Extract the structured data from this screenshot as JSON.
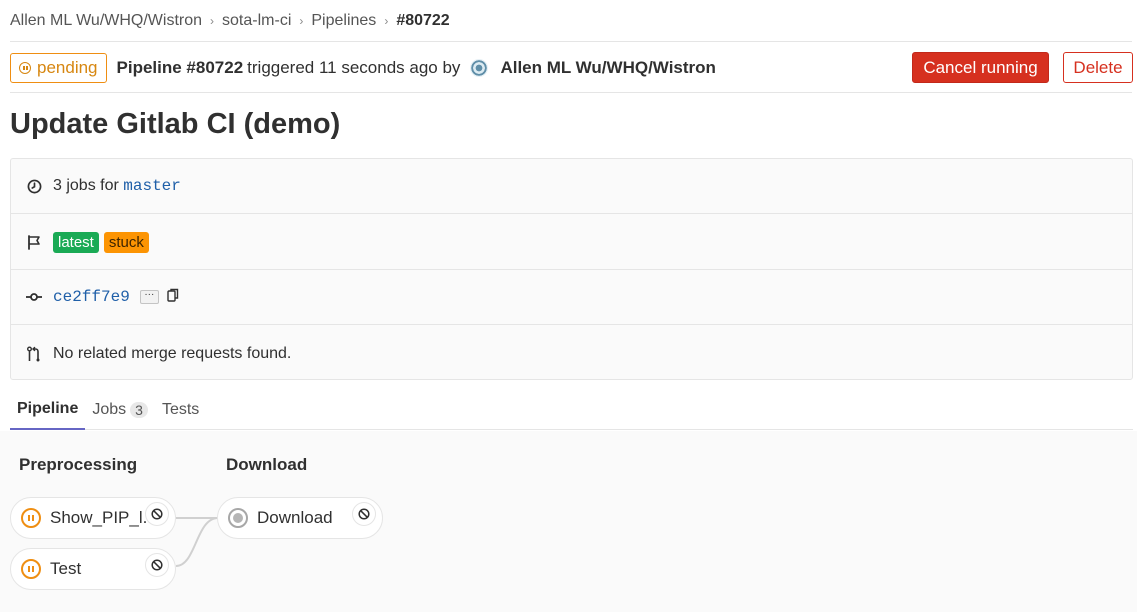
{
  "breadcrumb": {
    "items": [
      "Allen ML Wu/WHQ/Wistron",
      "sota-lm-ci",
      "Pipelines"
    ],
    "current": "#80722"
  },
  "header": {
    "status_label": "pending",
    "pipeline_label": "Pipeline #80722",
    "triggered_text": "triggered 11 seconds ago by",
    "user_name": "Allen ML Wu/WHQ/Wistron",
    "cancel_label": "Cancel running",
    "delete_label": "Delete"
  },
  "title": "Update Gitlab CI (demo)",
  "info": {
    "jobs_prefix": "3 jobs for",
    "branch": "master",
    "badges": [
      "latest",
      "stuck"
    ],
    "commit_sha": "ce2ff7e9",
    "ellipsis": "···",
    "merge_requests": "No related merge requests found."
  },
  "tabs": [
    {
      "label": "Pipeline",
      "count": null
    },
    {
      "label": "Jobs",
      "count": "3"
    },
    {
      "label": "Tests",
      "count": null
    }
  ],
  "stages": [
    {
      "name": "Preprocessing",
      "jobs": [
        {
          "name": "Show_PIP_l...",
          "status": "pending"
        },
        {
          "name": "Test",
          "status": "pending"
        }
      ]
    },
    {
      "name": "Download",
      "jobs": [
        {
          "name": "Download",
          "status": "created"
        }
      ]
    }
  ],
  "colors": {
    "pending": "#ef8e12",
    "danger": "#d6301f",
    "link": "#1f5fa8",
    "latest": "#1aaa55",
    "stuck": "#fc9403",
    "tab_active": "#6666c4"
  }
}
